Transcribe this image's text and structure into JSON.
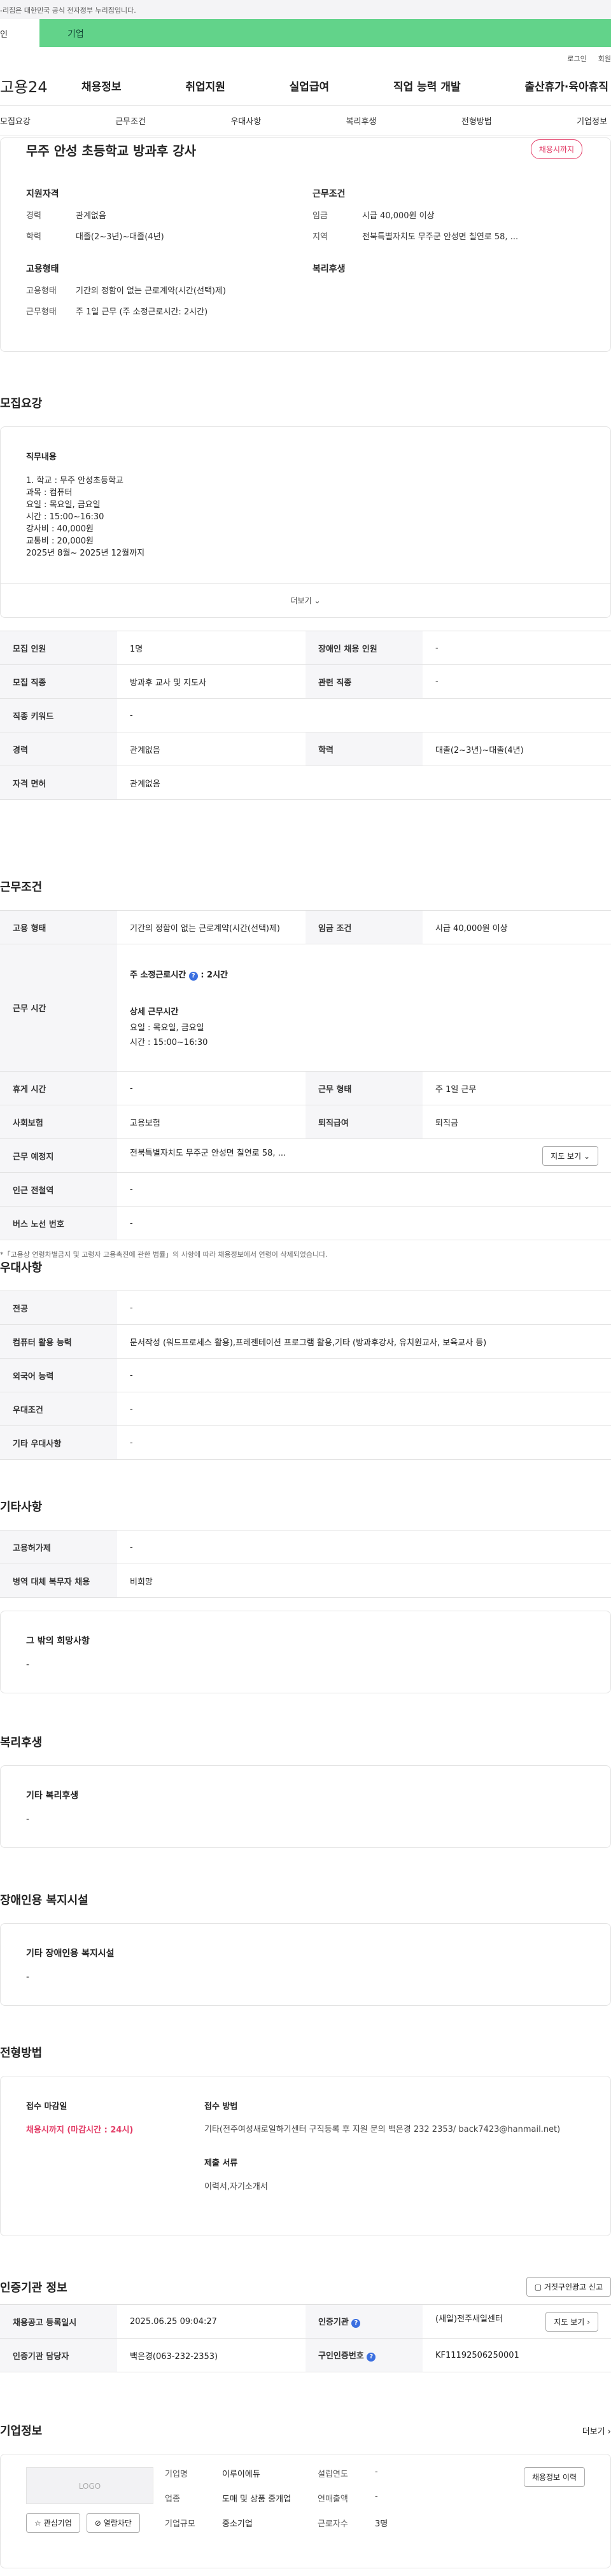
{
  "topbar": {
    "notice": "-리집은 대한민국 공식 전자정부 누리집입니다."
  },
  "banner": {
    "left": "인",
    "text": "기업"
  },
  "util": {
    "login": "로그인",
    "join": "회원"
  },
  "gnb": {
    "logo": "고용24",
    "items": [
      "채용정보",
      "취업지원",
      "실업급여",
      "직업 능력 개발",
      "출산휴가·육아휴직"
    ]
  },
  "subnav": {
    "items": [
      "모집요강",
      "근무조건",
      "우대사항",
      "복리후생",
      "전형방법",
      "기업정보"
    ]
  },
  "summary": {
    "title": "무주 안성 초등학교 방과후 강사",
    "badge": "채용시까지",
    "qual_title": "지원자격",
    "career_k": "경력",
    "career_v": "관계없음",
    "edu_k": "학력",
    "edu_v": "대졸(2~3년)~대졸(4년)",
    "cond_title": "근무조건",
    "wage_k": "임금",
    "wage_v": "시급 40,000원 이상",
    "region_k": "지역",
    "region_v": "전북특별자치도 무주군 안성면 칠연로 58, ...",
    "emp_title": "고용형태",
    "emptype_k": "고용형태",
    "emptype_v": "기간의 정함이 없는 근로계약(시간(선택)제)",
    "worktype_k": "근무형태",
    "worktype_v": "주 1일 근무 (주 소정근로시간: 2시간)",
    "welfare_title": "복리후생"
  },
  "recruit": {
    "title": "모집요강",
    "duty_title": "직무내용",
    "duty_lines": [
      "1. 학교 : 무주 안성초등학교",
      "과목 : 컴퓨터",
      "요일 : 목요일, 금요일",
      "시간 : 15:00~16:30",
      "강사비 : 40,000원",
      "교통비 : 20,000원",
      "2025년 8월~ 2025년 12월까지"
    ],
    "more": "더보기",
    "rows": {
      "count_k": "모집 인원",
      "count_v": "1명",
      "disab_k": "장애인 채용 인원",
      "disab_v": "-",
      "job_k": "모집 직종",
      "job_v": "방과후 교사 및 지도사",
      "rel_k": "관련 직종",
      "rel_v": "-",
      "kw_k": "직종 키워드",
      "kw_v": "-",
      "career_k": "경력",
      "career_v": "관계없음",
      "edu_k": "학력",
      "edu_v": "대졸(2~3년)~대졸(4년)",
      "lic_k": "자격 면허",
      "lic_v": "관계없음"
    }
  },
  "conditions": {
    "title": "근무조건",
    "emptype_k": "고용 형태",
    "emptype_v": "기간의 정함이 없는 근로계약(시간(선택)제)",
    "wage_k": "임금 조건",
    "wage_v": "시급 40,000원 이상",
    "time_k": "근무 시간",
    "weekly": "주 소정근로시간",
    "weekly_v": ": 2시간",
    "detail_title": "상세 근무시간",
    "detail_day": "요일 : 목요일, 금요일",
    "detail_time": "시간 : 15:00~16:30",
    "rest_k": "휴게 시간",
    "rest_v": "-",
    "form_k": "근무 형태",
    "form_v": "주 1일 근무",
    "ins_k": "사회보험",
    "ins_v": "고용보험",
    "sev_k": "퇴직급여",
    "sev_v": "퇴직금",
    "place_k": "근무 예정지",
    "place_v": "전북특별자치도 무주군 안성면 칠연로 58, ...",
    "map_btn": "지도 보기",
    "subway_k": "인근 전철역",
    "subway_v": "-",
    "bus_k": "버스 노선 번호",
    "bus_v": "-",
    "note": "*「고용상 연령차별금지 및 고령자 고용촉진에 관한 법률」의 사항에 따라 채용정보에서 연령이 삭제되었습니다."
  },
  "pref": {
    "title": "우대사항",
    "major_k": "전공",
    "major_v": "-",
    "pc_k": "컴퓨터 활용 능력",
    "pc_v": "문서작성 (워드프로세스 활용),프레젠테이션 프로그램 활용,기타 (방과후강사, 유치원교사, 보육교사 등)",
    "lang_k": "외국어 능력",
    "lang_v": "-",
    "cond_k": "우대조건",
    "cond_v": "-",
    "etc_k": "기타 우대사항",
    "etc_v": "-"
  },
  "other": {
    "title": "기타사항",
    "license_k": "고용허가제",
    "license_v": "-",
    "military_k": "병역 대체 복무자 채용",
    "military_v": "비희망",
    "other_title": "그 밖의 희망사항",
    "other_v": "-"
  },
  "welfare": {
    "title": "복리후생",
    "sub": "기타 복리후생",
    "v": "-"
  },
  "disab": {
    "title": "장애인용 복지시설",
    "sub": "기타 장애인용 복지시설",
    "v": "-"
  },
  "select": {
    "title": "전형방법",
    "deadline_k": "접수 마감일",
    "deadline_v": "채용시까지 (마감시간 : 24시)",
    "method_k": "접수 방법",
    "method_v": "기타(전주여성새로일하기센터 구직등록 후 지원 문의 백은경  232 2353/ back7423@hanmail.net)",
    "docs_k": "제출 서류",
    "docs_v": "이력서,자기소개서"
  },
  "cert": {
    "title": "인증기관 정보",
    "btn": "거짓구인광고 신고",
    "reg_k": "채용공고 등록일시",
    "reg_v": "2025.06.25 09:04:27",
    "org_k": "인증기관",
    "org_v": "(새일)전주새일센터",
    "map_btn": "지도 보기",
    "mgr_k": "인증기관 담당자",
    "mgr_v": "백은경(063-232-2353)",
    "no_k": "구인인증번호",
    "no_v": "KF11192506250001"
  },
  "company": {
    "title": "기업정보",
    "more": "더보기",
    "logo": "LOGO",
    "fav": "관심기업",
    "block": "열람차단",
    "name_k": "기업명",
    "name_v": "이루이에듀",
    "ind_k": "업종",
    "ind_v": "도매 및 상품 중개업",
    "size_k": "기업규모",
    "size_v": "중소기업",
    "year_k": "설립연도",
    "year_v": "-",
    "sales_k": "연매출액",
    "sales_v": "-",
    "emp_k": "근로자수",
    "emp_v": "3명",
    "hist_btn": "채용정보 이력"
  }
}
